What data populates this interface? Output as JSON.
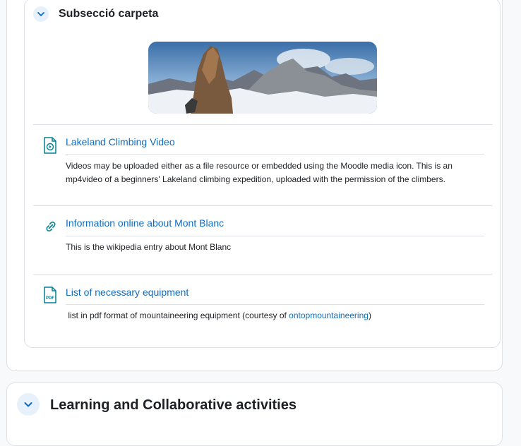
{
  "subsection": {
    "title": "Subsecció carpeta",
    "toggle_icon": "chevron-down-icon"
  },
  "banner": {
    "alt": "Mountain climbing banner image"
  },
  "activities": [
    {
      "icon": "video-file-icon",
      "title": "Lakeland Climbing Video",
      "description": "Videos may be uploaded either as a file resource or embedded using the Moodle media icon. This is an mp4video of a  beginners' Lakeland climbing expedition, uploaded with the permission  of the climbers."
    },
    {
      "icon": "link-icon",
      "title": "Information online about Mont Blanc",
      "description": "This is the wikipedia entry about Mont Blanc"
    },
    {
      "icon": "pdf-file-icon",
      "icon_label": "PDF",
      "title": "List of necessary equipment",
      "description_prefix": " list in pdf format of mountaineering equipment (courtesy of ",
      "description_link": "ontopmountaineering",
      "description_suffix": ")"
    }
  ],
  "learning_section": {
    "title": "Learning and Collaborative activities",
    "toggle_icon": "chevron-down-icon"
  },
  "colors": {
    "link": "#0f6cbf",
    "border": "#dee2e6",
    "icon_teal": "#008196",
    "toggle_bg": "#e7f1fb"
  }
}
